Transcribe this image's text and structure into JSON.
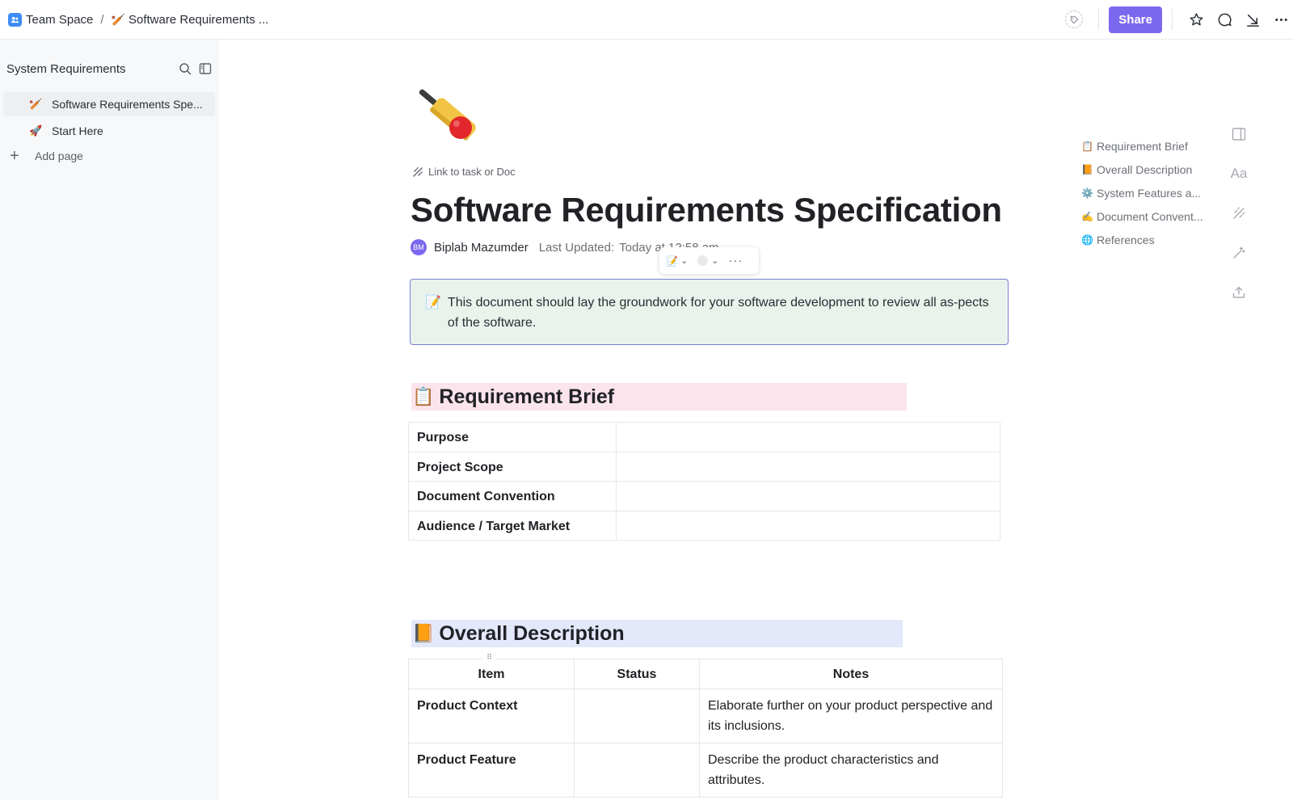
{
  "breadcrumb": {
    "space": "Team Space",
    "separator": "/",
    "doc_emoji": "🏏",
    "doc": "Software Requirements ..."
  },
  "toolbar": {
    "share_label": "Share",
    "accent_color": "#7b68ee"
  },
  "sidebar": {
    "title": "System Requirements",
    "items": [
      {
        "emoji": "🏏",
        "label": "Software Requirements Spe...",
        "active": true
      },
      {
        "emoji": "🚀",
        "label": "Start Here",
        "active": false
      }
    ],
    "add_page_label": "Add page"
  },
  "doc": {
    "cover_emoji": "🏏",
    "link_label": "Link to task or Doc",
    "title": "Software Requirements Specification",
    "author_initials": "BM",
    "author": "Biplab Mazumder",
    "updated_label": "Last Updated:",
    "updated_value": "Today at 12:58 am",
    "callout_emoji": "📝",
    "callout_text": "This document should lay the groundwork for your software development to review all as-pects of the software.",
    "floating_toolbar": {
      "emoji": "📝",
      "more": "···"
    }
  },
  "requirement_brief": {
    "emoji": "📋",
    "heading": "Requirement Brief",
    "rows": [
      {
        "key": "Purpose",
        "value": ""
      },
      {
        "key": "Project Scope",
        "value": ""
      },
      {
        "key": "Document Convention",
        "value": ""
      },
      {
        "key": "Audience / Target Market",
        "value": ""
      }
    ]
  },
  "overall_description": {
    "emoji": "📙",
    "heading": "Overall Description",
    "columns": [
      "Item",
      "Status",
      "Notes"
    ],
    "rows": [
      {
        "item": "Product Context",
        "status": "",
        "notes": "Elaborate further on your product perspective and its inclusions."
      },
      {
        "item": "Product Feature",
        "status": "",
        "notes": "Describe the product characteristics and attributes."
      }
    ]
  },
  "toc": [
    {
      "emoji": "📋",
      "label": "Requirement Brief"
    },
    {
      "emoji": "📙",
      "label": "Overall Description"
    },
    {
      "emoji": "⚙️",
      "label": "System Features a..."
    },
    {
      "emoji": "✍️",
      "label": "Document Convent..."
    },
    {
      "emoji": "🌐",
      "label": "References"
    }
  ],
  "right_rail": {
    "font_icon_label": "Aa"
  }
}
